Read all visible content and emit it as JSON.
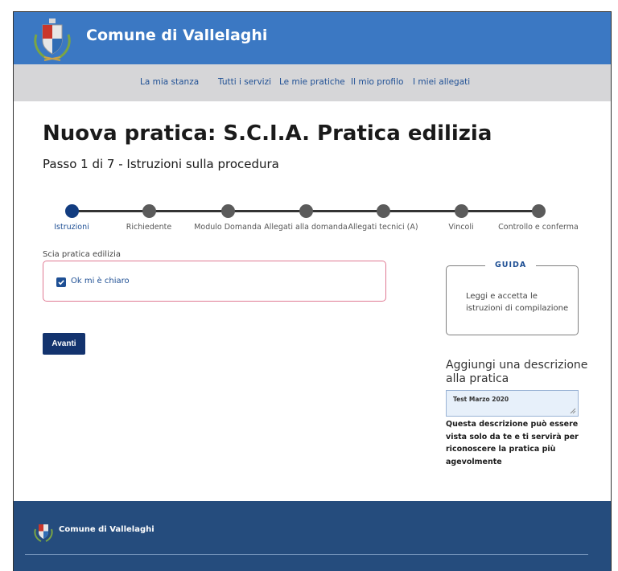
{
  "header": {
    "site_title": "Comune di Vallelaghi",
    "logo_icon": "coat-of-arms-icon",
    "bg_color": "#3b78c3"
  },
  "nav": {
    "items": [
      "La mia stanza",
      "Tutti i servizi",
      "Le mie pratiche",
      "Il mio profilo",
      "I miei allegati"
    ]
  },
  "page": {
    "title": "Nuova pratica: S.C.I.A. Pratica edilizia",
    "step_title": "Passo 1 di 7 - Istruzioni sulla procedura"
  },
  "stepper": {
    "current_step": 1,
    "total_steps": 7,
    "steps": [
      "Istruzioni",
      "Richiedente",
      "Modulo Domanda",
      "Allegati alla domanda",
      "Allegati tecnici (A)",
      "Vincoli",
      "Controllo e conferma"
    ],
    "active_color": "#123c80"
  },
  "form": {
    "field_label": "Scia pratica edilizia",
    "checkbox_label": "Ok mi è chiaro",
    "checkbox_checked": true,
    "next_button": "Avanti"
  },
  "guide": {
    "title": "GUIDA",
    "text": "Leggi e accetta le istruzioni di compilazione"
  },
  "description": {
    "label": "Aggiungi una descrizione alla pratica",
    "value": "Test Marzo 2020",
    "help": "Questa descrizione può essere vista solo da te e ti servirà per riconoscere la pratica più agevolmente"
  },
  "footer": {
    "title": "Comune di Vallelaghi",
    "bg_color": "#254c7d"
  }
}
